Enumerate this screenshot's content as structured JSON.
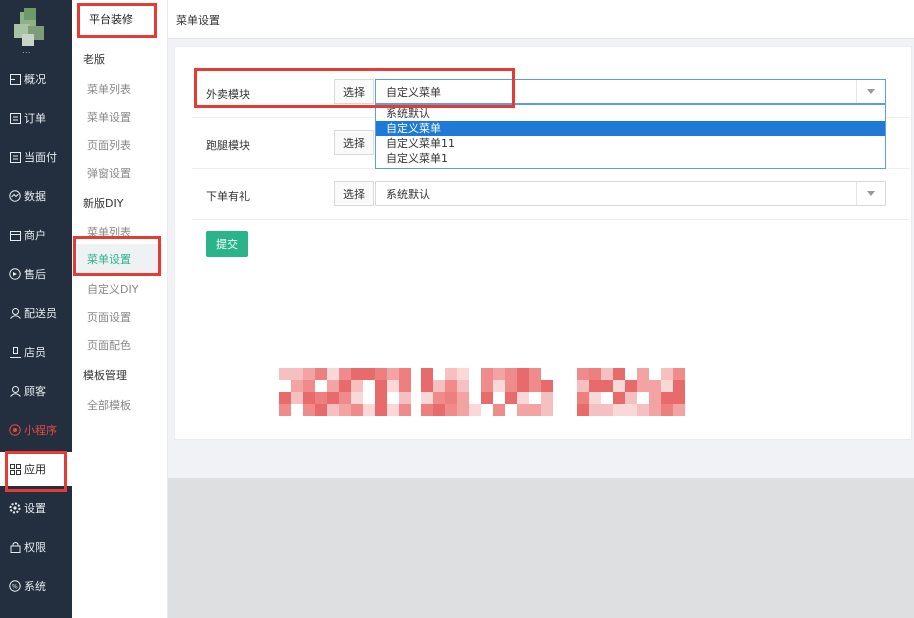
{
  "colors": {
    "accent": "#2bb38a",
    "nav_bg": "#232f3e",
    "highlight": "#e53b35",
    "dropdown_selected": "#1e7ad6"
  },
  "nav": {
    "user_name": "...",
    "items": [
      {
        "label": "概况",
        "icon": "dashboard-icon"
      },
      {
        "label": "订单",
        "icon": "order-icon"
      },
      {
        "label": "当面付",
        "icon": "payment-icon"
      },
      {
        "label": "数据",
        "icon": "chart-icon"
      },
      {
        "label": "商户",
        "icon": "store-icon"
      },
      {
        "label": "售后",
        "icon": "aftersale-icon"
      },
      {
        "label": "配送员",
        "icon": "courier-icon"
      },
      {
        "label": "店员",
        "icon": "clerk-icon"
      },
      {
        "label": "顾客",
        "icon": "customer-icon"
      },
      {
        "label": "小程序",
        "icon": "miniprogram-icon"
      },
      {
        "label": "应用",
        "icon": "apps-icon"
      },
      {
        "label": "设置",
        "icon": "gear-icon"
      },
      {
        "label": "权限",
        "icon": "lock-icon"
      },
      {
        "label": "系统",
        "icon": "system-icon"
      }
    ]
  },
  "subnav": {
    "header": "平台装修",
    "old_section": "老版",
    "old_items": [
      "菜单列表",
      "菜单设置",
      "页面列表",
      "弹窗设置"
    ],
    "diy_section": "新版DIY",
    "diy_items": [
      "菜单列表",
      "菜单设置",
      "自定义DIY",
      "页面设置",
      "页面配色"
    ],
    "template_section": "模板管理",
    "template_items": [
      "全部模板"
    ]
  },
  "page": {
    "title": "菜单设置"
  },
  "form": {
    "rows": [
      {
        "label": "外卖模块",
        "select_label": "选择",
        "value": "自定义菜单"
      },
      {
        "label": "跑腿模块",
        "select_label": "选择",
        "value": ""
      },
      {
        "label": "下单有礼",
        "select_label": "选择",
        "value": "系统默认"
      }
    ],
    "dropdown_options": [
      "系统默认",
      "自定义菜单",
      "自定义菜单11",
      "自定义菜单1"
    ],
    "dropdown_selected_index": 1,
    "submit_label": "提交"
  }
}
